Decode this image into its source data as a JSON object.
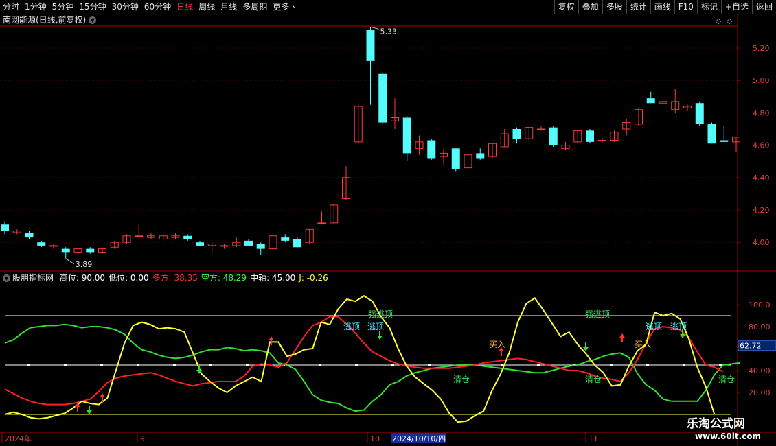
{
  "toolbar": {
    "periods": [
      "分时",
      "1分钟",
      "5分钟",
      "15分钟",
      "30分钟",
      "60分钟",
      "日线",
      "周线",
      "月线",
      "多周期",
      "更多"
    ],
    "active_period": "日线",
    "more_arrow": "›",
    "right_buttons": [
      "复权",
      "叠加",
      "多股",
      "统计",
      "画线",
      "F10",
      "标记",
      "+自选",
      "返回"
    ]
  },
  "main_chart": {
    "stock_title": "南网能源(日线,前复权)",
    "dropdown_icon": "chevron-down-icon",
    "high_label": "5.33",
    "low_label": "3.89",
    "price_ticks": [
      "5.20",
      "5.00",
      "4.80",
      "4.60",
      "4.40",
      "4.20",
      "4.00"
    ],
    "colors": {
      "up": "#ff3b3b",
      "down": "#54fcfc",
      "axis": "#b00000",
      "grid": "#5a0000"
    }
  },
  "indicator": {
    "name": "股朋指标网",
    "params": [
      {
        "label": "高位:",
        "value": "90.00",
        "color": "#ffffff"
      },
      {
        "label": "低位:",
        "value": "0.00",
        "color": "#ffffff"
      },
      {
        "label": "多方:",
        "value": "38.35",
        "color": "#ff3030"
      },
      {
        "label": "空方:",
        "value": "48.29",
        "color": "#30ff30"
      },
      {
        "label": "中轴:",
        "value": "45.00",
        "color": "#ffffff"
      },
      {
        "label": "J:",
        "value": "-0.26",
        "color": "#ffff40"
      }
    ],
    "ticks": [
      "100.0",
      "80.00",
      "60.00",
      "40.00",
      "20.00"
    ],
    "current_value": "62.72",
    "signals": {
      "escape": "逃顶",
      "strong_escape": "强逃顶",
      "clear": "清仓",
      "buy": "买入"
    }
  },
  "date_axis": {
    "labels": [
      "2024年",
      "9",
      "10",
      "11"
    ],
    "cursor_date": "2024/10/10/四"
  },
  "watermark": {
    "name": "乐淘公式网",
    "url": "www.60lt.com"
  },
  "chart_data": {
    "type": "candlestick",
    "series": [
      {
        "name": "K",
        "candles": [
          [
            4.11,
            4.13,
            4.05,
            4.07
          ],
          [
            4.06,
            4.08,
            4.05,
            4.07
          ],
          [
            4.06,
            4.07,
            4.02,
            4.03
          ],
          [
            4.0,
            4.01,
            3.97,
            3.98
          ],
          [
            3.98,
            3.99,
            3.96,
            3.98
          ],
          [
            3.96,
            3.97,
            3.9,
            3.94
          ],
          [
            3.94,
            3.97,
            3.91,
            3.96
          ],
          [
            3.96,
            3.97,
            3.93,
            3.94
          ],
          [
            3.94,
            3.97,
            3.93,
            3.96
          ],
          [
            3.97,
            4.01,
            3.96,
            4.0
          ],
          [
            4.0,
            4.05,
            3.99,
            4.04
          ],
          [
            4.04,
            4.11,
            4.04,
            4.04
          ],
          [
            4.03,
            4.06,
            4.02,
            4.04
          ],
          [
            4.02,
            4.05,
            4.01,
            4.04
          ],
          [
            4.03,
            4.06,
            4.02,
            4.04
          ],
          [
            4.04,
            4.05,
            4.01,
            4.02
          ],
          [
            4.0,
            4.01,
            3.98,
            3.98
          ],
          [
            3.98,
            4.0,
            3.93,
            3.99
          ],
          [
            3.98,
            3.99,
            3.96,
            3.98
          ],
          [
            3.98,
            4.03,
            3.97,
            4.0
          ],
          [
            4.01,
            4.02,
            3.98,
            3.98
          ],
          [
            3.99,
            4.0,
            3.92,
            3.96
          ],
          [
            3.96,
            4.06,
            3.95,
            4.04
          ],
          [
            4.03,
            4.05,
            4.0,
            4.01
          ],
          [
            4.02,
            4.03,
            3.97,
            3.97
          ],
          [
            4.0,
            4.08,
            3.99,
            4.08
          ],
          [
            4.12,
            4.19,
            4.11,
            4.12
          ],
          [
            4.12,
            4.24,
            4.11,
            4.23
          ],
          [
            4.27,
            4.47,
            4.26,
            4.4
          ],
          [
            4.62,
            4.86,
            4.61,
            4.84
          ],
          [
            5.31,
            5.33,
            4.85,
            5.12
          ],
          [
            5.04,
            5.05,
            4.73,
            4.74
          ],
          [
            4.75,
            4.89,
            4.7,
            4.77
          ],
          [
            4.77,
            4.78,
            4.5,
            4.55
          ],
          [
            4.58,
            4.66,
            4.54,
            4.62
          ],
          [
            4.63,
            4.64,
            4.51,
            4.52
          ],
          [
            4.53,
            4.58,
            4.48,
            4.55
          ],
          [
            4.58,
            4.58,
            4.44,
            4.45
          ],
          [
            4.46,
            4.61,
            4.42,
            4.54
          ],
          [
            4.55,
            4.58,
            4.51,
            4.52
          ],
          [
            4.53,
            4.61,
            4.52,
            4.61
          ],
          [
            4.59,
            4.7,
            4.59,
            4.67
          ],
          [
            4.7,
            4.71,
            4.61,
            4.64
          ],
          [
            4.64,
            4.71,
            4.63,
            4.71
          ],
          [
            4.7,
            4.72,
            4.69,
            4.7
          ],
          [
            4.71,
            4.72,
            4.59,
            4.6
          ],
          [
            4.58,
            4.62,
            4.57,
            4.6
          ],
          [
            4.62,
            4.69,
            4.61,
            4.69
          ],
          [
            4.69,
            4.7,
            4.61,
            4.62
          ],
          [
            4.63,
            4.65,
            4.61,
            4.63
          ],
          [
            4.63,
            4.69,
            4.62,
            4.68
          ],
          [
            4.7,
            4.76,
            4.66,
            4.74
          ],
          [
            4.73,
            4.83,
            4.72,
            4.82
          ],
          [
            4.89,
            4.93,
            4.86,
            4.86
          ],
          [
            4.86,
            4.88,
            4.8,
            4.87
          ],
          [
            4.82,
            4.95,
            4.8,
            4.87
          ],
          [
            4.83,
            4.85,
            4.81,
            4.84
          ],
          [
            4.86,
            4.87,
            4.72,
            4.73
          ],
          [
            4.73,
            4.74,
            4.61,
            4.61
          ],
          [
            4.63,
            4.72,
            4.62,
            4.62
          ],
          [
            4.62,
            4.65,
            4.56,
            4.65
          ]
        ]
      }
    ],
    "indicator_series": [
      {
        "name": "多方",
        "values": [
          23,
          19,
          15,
          12,
          10,
          9,
          9,
          9,
          10,
          12,
          14,
          21,
          29,
          33,
          35,
          36,
          37,
          38,
          36,
          33,
          30,
          28,
          26,
          28,
          29,
          30,
          30,
          30,
          35,
          44,
          46,
          45,
          43,
          47,
          59,
          71,
          81,
          84,
          89,
          89,
          82,
          74,
          65,
          57,
          53,
          49,
          46,
          44,
          43,
          42,
          42,
          42,
          42,
          43,
          44,
          45,
          47,
          48,
          49,
          50,
          51,
          50,
          48,
          46,
          44,
          42,
          40,
          40,
          38,
          35,
          33,
          32,
          30,
          38,
          50,
          65,
          78,
          80,
          79,
          77,
          70,
          57,
          45,
          43,
          39
        ]
      },
      {
        "name": "空方",
        "values": [
          65,
          68,
          74,
          79,
          80,
          81,
          81,
          82,
          81,
          79,
          80,
          80,
          79,
          77,
          73,
          65,
          59,
          57,
          54,
          52,
          51,
          52,
          54,
          57,
          59,
          59,
          61,
          60,
          58,
          59,
          58,
          56,
          47,
          45,
          41,
          30,
          18,
          13,
          11,
          10,
          6,
          3,
          4,
          12,
          18,
          27,
          30,
          35,
          38,
          40,
          42,
          43,
          44,
          45,
          45,
          45,
          44,
          43,
          42,
          41,
          40,
          39,
          38,
          38,
          40,
          42,
          44,
          45,
          48,
          50,
          53,
          55,
          56,
          52,
          37,
          27,
          22,
          14,
          12,
          12,
          12,
          12,
          22,
          36,
          45,
          46,
          47
        ]
      },
      {
        "name": "J",
        "values": [
          0,
          2,
          0,
          -3,
          -4,
          -3,
          -1,
          1,
          6,
          12,
          10,
          9,
          15,
          40,
          65,
          81,
          84,
          82,
          78,
          79,
          78,
          75,
          56,
          37,
          30,
          24,
          20,
          26,
          30,
          34,
          30,
          66,
          66,
          53,
          55,
          59,
          60,
          84,
          82,
          96,
          105,
          103,
          108,
          103,
          89,
          79,
          60,
          44,
          34,
          28,
          22,
          14,
          1,
          -7,
          -6,
          -1,
          3,
          22,
          37,
          56,
          84,
          101,
          106,
          95,
          83,
          71,
          75,
          64,
          55,
          45,
          38,
          26,
          27,
          44,
          58,
          64,
          93,
          90,
          92,
          87,
          69,
          43,
          25,
          0
        ]
      },
      {
        "name": "中轴",
        "values": [
          45
        ]
      },
      {
        "name": "高位",
        "values": [
          90
        ]
      },
      {
        "name": "低位",
        "values": [
          0
        ]
      }
    ]
  }
}
